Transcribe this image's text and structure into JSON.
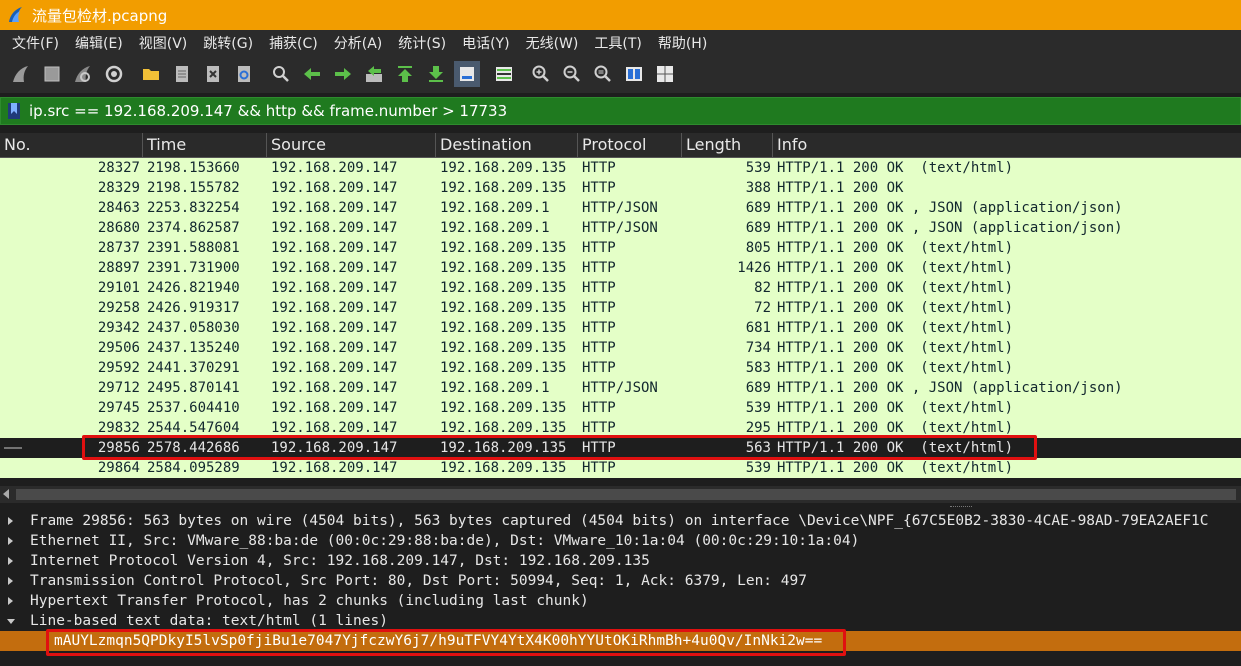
{
  "window": {
    "title": "流量包检材.pcapng"
  },
  "menu": [
    "文件(F)",
    "编辑(E)",
    "视图(V)",
    "跳转(G)",
    "捕获(C)",
    "分析(A)",
    "统计(S)",
    "电话(Y)",
    "无线(W)",
    "工具(T)",
    "帮助(H)"
  ],
  "filter": {
    "value": "ip.src == 192.168.209.147 && http && frame.number > 17733"
  },
  "columns": {
    "no": "No.",
    "time": "Time",
    "source": "Source",
    "destination": "Destination",
    "protocol": "Protocol",
    "length": "Length",
    "info": "Info"
  },
  "packets": [
    {
      "no": "28327",
      "time": "2198.153660",
      "src": "192.168.209.147",
      "dst": "192.168.209.135",
      "proto": "HTTP",
      "len": "539",
      "info": "HTTP/1.1 200 OK  (text/html)"
    },
    {
      "no": "28329",
      "time": "2198.155782",
      "src": "192.168.209.147",
      "dst": "192.168.209.135",
      "proto": "HTTP",
      "len": "388",
      "info": "HTTP/1.1 200 OK"
    },
    {
      "no": "28463",
      "time": "2253.832254",
      "src": "192.168.209.147",
      "dst": "192.168.209.1",
      "proto": "HTTP/JSON",
      "len": "689",
      "info": "HTTP/1.1 200 OK , JSON (application/json)"
    },
    {
      "no": "28680",
      "time": "2374.862587",
      "src": "192.168.209.147",
      "dst": "192.168.209.1",
      "proto": "HTTP/JSON",
      "len": "689",
      "info": "HTTP/1.1 200 OK , JSON (application/json)"
    },
    {
      "no": "28737",
      "time": "2391.588081",
      "src": "192.168.209.147",
      "dst": "192.168.209.135",
      "proto": "HTTP",
      "len": "805",
      "info": "HTTP/1.1 200 OK  (text/html)"
    },
    {
      "no": "28897",
      "time": "2391.731900",
      "src": "192.168.209.147",
      "dst": "192.168.209.135",
      "proto": "HTTP",
      "len": "1426",
      "info": "HTTP/1.1 200 OK  (text/html)"
    },
    {
      "no": "29101",
      "time": "2426.821940",
      "src": "192.168.209.147",
      "dst": "192.168.209.135",
      "proto": "HTTP",
      "len": "82",
      "info": "HTTP/1.1 200 OK  (text/html)"
    },
    {
      "no": "29258",
      "time": "2426.919317",
      "src": "192.168.209.147",
      "dst": "192.168.209.135",
      "proto": "HTTP",
      "len": "72",
      "info": "HTTP/1.1 200 OK  (text/html)"
    },
    {
      "no": "29342",
      "time": "2437.058030",
      "src": "192.168.209.147",
      "dst": "192.168.209.135",
      "proto": "HTTP",
      "len": "681",
      "info": "HTTP/1.1 200 OK  (text/html)"
    },
    {
      "no": "29506",
      "time": "2437.135240",
      "src": "192.168.209.147",
      "dst": "192.168.209.135",
      "proto": "HTTP",
      "len": "734",
      "info": "HTTP/1.1 200 OK  (text/html)"
    },
    {
      "no": "29592",
      "time": "2441.370291",
      "src": "192.168.209.147",
      "dst": "192.168.209.135",
      "proto": "HTTP",
      "len": "583",
      "info": "HTTP/1.1 200 OK  (text/html)"
    },
    {
      "no": "29712",
      "time": "2495.870141",
      "src": "192.168.209.147",
      "dst": "192.168.209.1",
      "proto": "HTTP/JSON",
      "len": "689",
      "info": "HTTP/1.1 200 OK , JSON (application/json)"
    },
    {
      "no": "29745",
      "time": "2537.604410",
      "src": "192.168.209.147",
      "dst": "192.168.209.135",
      "proto": "HTTP",
      "len": "539",
      "info": "HTTP/1.1 200 OK  (text/html)"
    },
    {
      "no": "29832",
      "time": "2544.547604",
      "src": "192.168.209.147",
      "dst": "192.168.209.135",
      "proto": "HTTP",
      "len": "295",
      "info": "HTTP/1.1 200 OK  (text/html)"
    },
    {
      "no": "29856",
      "time": "2578.442686",
      "src": "192.168.209.147",
      "dst": "192.168.209.135",
      "proto": "HTTP",
      "len": "563",
      "info": "HTTP/1.1 200 OK  (text/html)",
      "selected": true
    },
    {
      "no": "29864",
      "time": "2584.095289",
      "src": "192.168.209.147",
      "dst": "192.168.209.135",
      "proto": "HTTP",
      "len": "539",
      "info": "HTTP/1.1 200 OK  (text/html)"
    }
  ],
  "details": [
    {
      "text": "Frame 29856: 563 bytes on wire (4504 bits), 563 bytes captured (4504 bits) on interface \\Device\\NPF_{67C5E0B2-3830-4CAE-98AD-79EA2AEF1C",
      "expanded": false
    },
    {
      "text": "Ethernet II, Src: VMware_88:ba:de (00:0c:29:88:ba:de), Dst: VMware_10:1a:04 (00:0c:29:10:1a:04)",
      "expanded": false
    },
    {
      "text": "Internet Protocol Version 4, Src: 192.168.209.147, Dst: 192.168.209.135",
      "expanded": false
    },
    {
      "text": "Transmission Control Protocol, Src Port: 80, Dst Port: 50994, Seq: 1, Ack: 6379, Len: 497",
      "expanded": false
    },
    {
      "text": "Hypertext Transfer Protocol, has 2 chunks (including last chunk)",
      "expanded": false
    },
    {
      "text": "Line-based text data: text/html (1 lines)",
      "expanded": true
    },
    {
      "text": "mAUYLzmqn5QPDkyI5lvSp0fjiBu1e7047YjfczwY6j7/h9uTFVY4YtX4K00hYYUtOKiRhmBh+4u0Qv/InNki2w==",
      "child": true
    }
  ],
  "colors": {
    "titlebar": "#f29d00",
    "filter_ok": "#1f7a1f",
    "list_bg": "#e4ffc7",
    "detail_highlight": "#c36d0e",
    "annotation": "#e01010"
  },
  "icons": [
    "shark-fin-start-icon",
    "stop-icon",
    "restart-fin-icon",
    "options-gear-icon",
    "open-folder-icon",
    "save-file-icon",
    "close-file-icon",
    "reload-icon",
    "find-icon",
    "go-back-icon",
    "go-forward-icon",
    "go-to-packet-icon",
    "go-first-icon",
    "go-last-icon",
    "autoscroll-icon",
    "colorize-icon",
    "zoom-in-icon",
    "zoom-out-icon",
    "zoom-normal-icon",
    "resize-columns-icon",
    "layout-icon"
  ]
}
